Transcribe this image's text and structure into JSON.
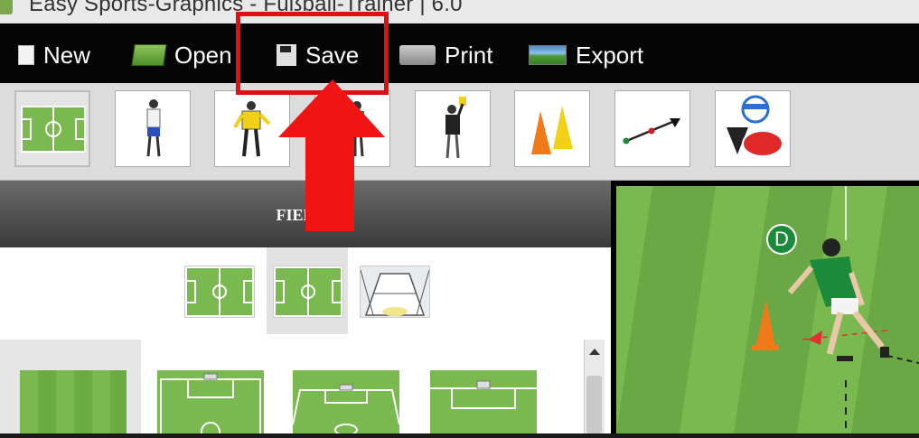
{
  "window": {
    "title": "Easy Sports-Graphics - Fußball-Trainer | 6.0"
  },
  "menu": {
    "items": [
      {
        "label": "New",
        "icon": "new-document-icon"
      },
      {
        "label": "Open",
        "icon": "open-folder-icon"
      },
      {
        "label": "Save",
        "icon": "floppy-disk-icon"
      },
      {
        "label": "Print",
        "icon": "printer-icon"
      },
      {
        "label": "Export",
        "icon": "export-image-icon"
      }
    ]
  },
  "annotation": {
    "highlight": "Save",
    "color": "#e01010"
  },
  "toolbar": {
    "tools": [
      {
        "icon": "field-icon",
        "selected": true
      },
      {
        "icon": "player-white-icon"
      },
      {
        "icon": "goalkeeper-icon"
      },
      {
        "icon": "player-green-icon"
      },
      {
        "icon": "referee-icon"
      },
      {
        "icon": "cones-icon"
      },
      {
        "icon": "line-arrow-icon"
      },
      {
        "icon": "shapes-icon"
      }
    ]
  },
  "sidepanel": {
    "header": "FIELDS",
    "field_types": [
      {
        "icon": "full-field-horizontal-icon"
      },
      {
        "icon": "full-field-selected-icon",
        "selected": true
      },
      {
        "icon": "stadium-perspective-icon"
      }
    ]
  },
  "canvas": {
    "marker_label": "D"
  },
  "colors": {
    "pitch": "#7ab94f",
    "pitch_dark": "#63a33c",
    "accent_red": "#e01010"
  }
}
